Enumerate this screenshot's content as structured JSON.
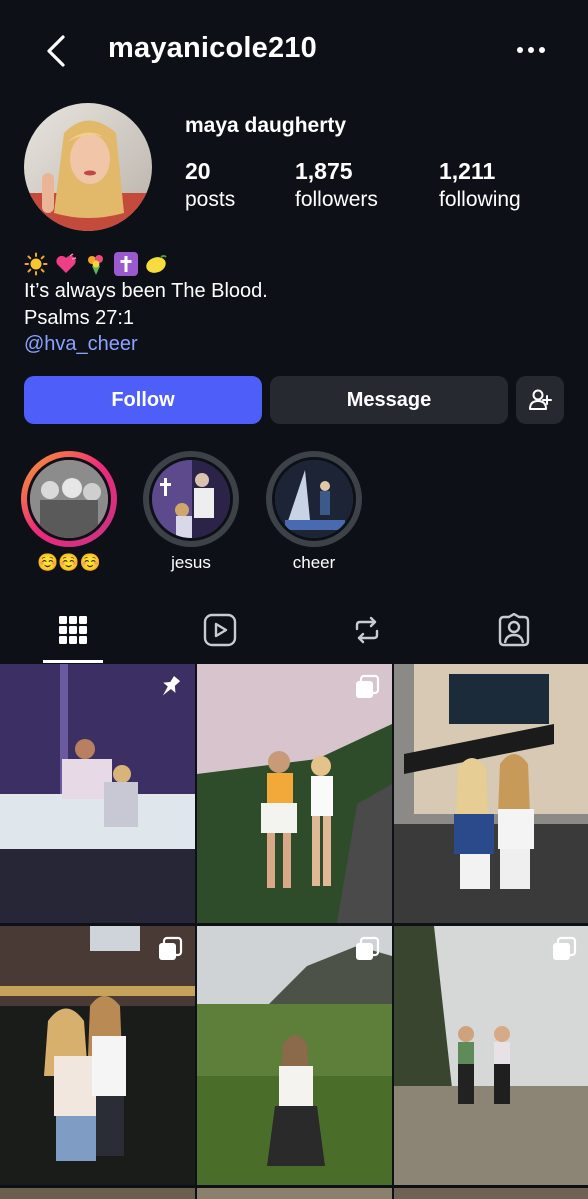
{
  "header": {
    "username": "mayanicole210"
  },
  "profile": {
    "display_name": "maya daugherty",
    "stats": [
      {
        "value": "20",
        "label": "posts"
      },
      {
        "value": "1,875",
        "label": "followers"
      },
      {
        "value": "1,211",
        "label": "following"
      }
    ],
    "bio_emojis": [
      "sun",
      "heart",
      "bouquet",
      "cross",
      "lemon"
    ],
    "bio_line1": "It’s always been The Blood.",
    "bio_line2": "Psalms 27:1",
    "bio_link": "@hva_cheer"
  },
  "actions": {
    "follow_label": "Follow",
    "message_label": "Message",
    "add_icon": "add-person-icon"
  },
  "highlights": [
    {
      "label": "☺️☺️☺️",
      "ring": "gradient"
    },
    {
      "label": "jesus",
      "ring": "gray"
    },
    {
      "label": "cheer",
      "ring": "gray"
    }
  ],
  "tabs": [
    "grid-icon",
    "reels-icon",
    "reposts-icon",
    "tagged-icon"
  ],
  "colors": {
    "background": "#0d1117",
    "follow_button": "#4d5ef9",
    "secondary_button": "#262a30",
    "link": "#8aa3ff"
  },
  "grid_badges": [
    "pin",
    "carousel",
    "none",
    "carousel",
    "carousel",
    "carousel"
  ]
}
